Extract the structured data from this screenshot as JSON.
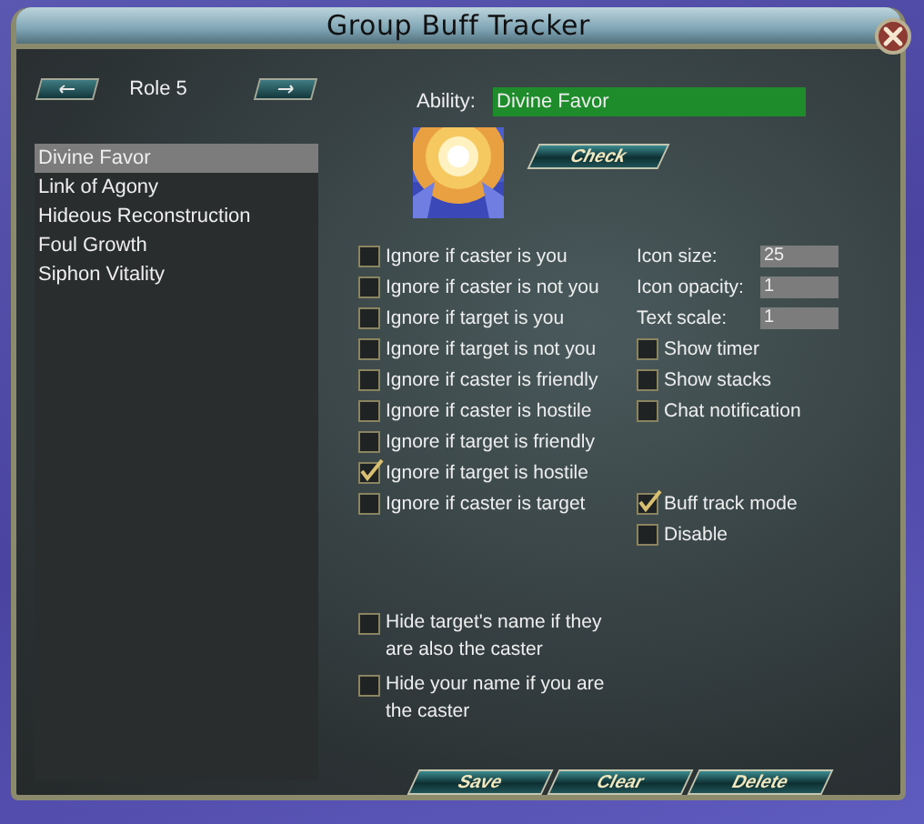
{
  "window": {
    "title": "Group Buff Tracker"
  },
  "role": {
    "label": "Role 5"
  },
  "abilities": [
    {
      "name": "Divine Favor",
      "selected": true
    },
    {
      "name": "Link of Agony",
      "selected": false
    },
    {
      "name": "Hideous Reconstruction",
      "selected": false
    },
    {
      "name": "Foul Growth",
      "selected": false
    },
    {
      "name": "Siphon Vitality",
      "selected": false
    }
  ],
  "ability_field": {
    "label": "Ability:",
    "value": "Divine Favor"
  },
  "check_button": "Check",
  "filters": [
    {
      "label": "Ignore if caster is you",
      "checked": false
    },
    {
      "label": "Ignore if caster is not you",
      "checked": false
    },
    {
      "label": "Ignore if target is you",
      "checked": false
    },
    {
      "label": "Ignore if target is not you",
      "checked": false
    },
    {
      "label": "Ignore if caster is friendly",
      "checked": false
    },
    {
      "label": "Ignore if caster is hostile",
      "checked": false
    },
    {
      "label": "Ignore if target is friendly",
      "checked": false
    },
    {
      "label": "Ignore if target is hostile",
      "checked": true
    },
    {
      "label": "Ignore if caster is target",
      "checked": false
    }
  ],
  "settings_fields": [
    {
      "label": "Icon size:",
      "value": "25"
    },
    {
      "label": "Icon opacity:",
      "value": "1"
    },
    {
      "label": "Text scale:",
      "value": "1"
    }
  ],
  "options": [
    {
      "label": "Show timer",
      "checked": false
    },
    {
      "label": "Show stacks",
      "checked": false
    },
    {
      "label": "Chat notification",
      "checked": false
    }
  ],
  "mode_options": [
    {
      "label": "Buff track mode",
      "checked": true
    },
    {
      "label": "Disable",
      "checked": false
    }
  ],
  "name_options": [
    {
      "label": "Hide target's name if they are also the caster",
      "checked": false
    },
    {
      "label": "Hide your name if you are the caster",
      "checked": false
    }
  ],
  "buttons": [
    "Save",
    "Clear",
    "Delete"
  ]
}
